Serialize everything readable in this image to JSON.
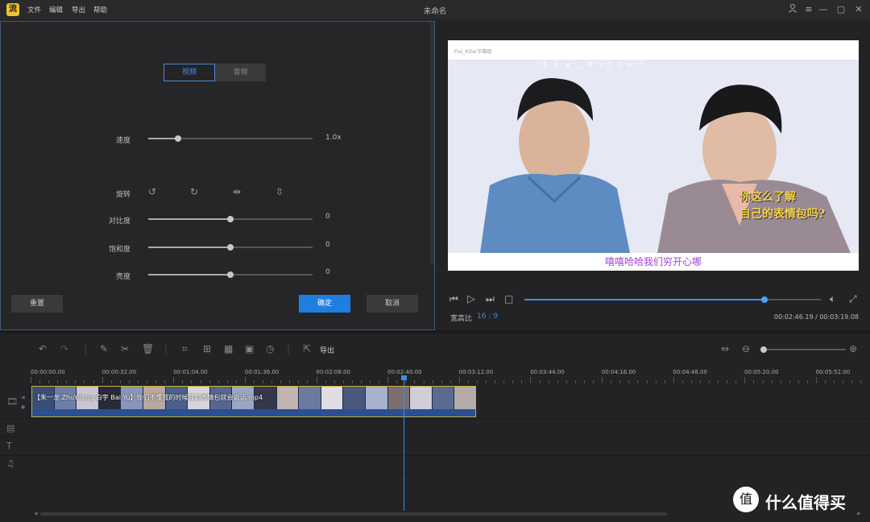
{
  "app": {
    "logo_char": "流",
    "title": "未命名",
    "menu": [
      "文件",
      "编辑",
      "导出",
      "帮助"
    ]
  },
  "editor": {
    "tabs": [
      "视频",
      "音频"
    ],
    "speed": {
      "label": "速度",
      "value": "1.0x",
      "level": 0.18
    },
    "rotate": {
      "label": "旋转"
    },
    "contrast": {
      "label": "对比度",
      "value": "0",
      "level": 0.5
    },
    "saturation": {
      "label": "饱和度",
      "value": "0",
      "level": 0.5
    },
    "brightness": {
      "label": "亮度",
      "value": "0",
      "level": 0.5
    },
    "reset": "重置",
    "ok": "确定",
    "cancel": "取消"
  },
  "preview": {
    "top_text": "Fox_Killer字幕组",
    "banner": "F o x _ K i l l e r",
    "bubble": [
      "你这么了解",
      "自己的表情包吗?"
    ],
    "subtitle": "嘻嘻哈哈我们穷开心哪",
    "aspect_label": "宽高比",
    "aspect_value": "16 : 9",
    "time": "00:02:46.19 / 00:03:19.08",
    "progress": 0.81
  },
  "toolbar": {
    "export": "导出",
    "zoom_level": 0.02
  },
  "ruler": [
    "00:00:00.00",
    "00:00:32.00",
    "00:01:04.00",
    "00:01:36.00",
    "00:02:08.00",
    "00:02:40.00",
    "00:03:12.00",
    "00:03:44.00",
    "00:04:16.00",
    "00:04:48.00",
    "00:05:20.00",
    "00:05:52.00"
  ],
  "clip": {
    "label": "【朱一龙 ZhuYilong 白宇 Bai Yu】你们不懂我的时候我的表情包就会说话.mp4"
  },
  "watermark": "什么值得买",
  "colors": {
    "accent": "#3a8ee6",
    "ok_button": "#1e7fe0",
    "subtitle": "#a042d8",
    "clip_border": "#c8b030"
  }
}
